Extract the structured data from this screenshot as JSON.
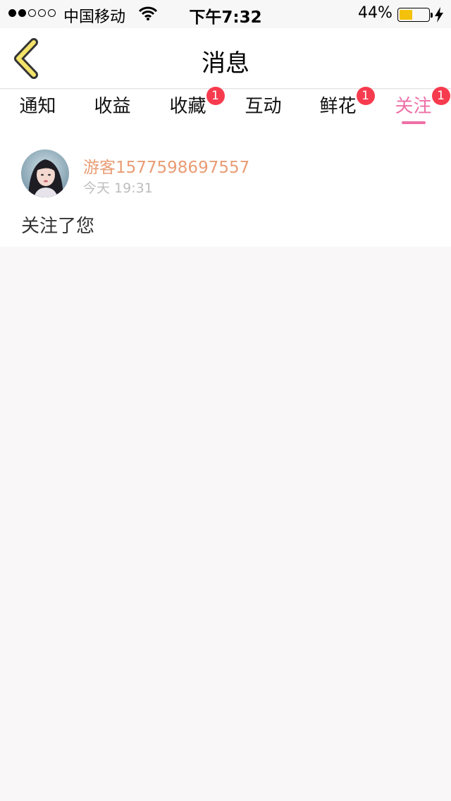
{
  "status_bar": {
    "carrier": "中国移动",
    "time": "下午7:32",
    "battery_percent": "44%",
    "battery_level": 0.44,
    "signal_filled": 2,
    "signal_total": 5,
    "icons": [
      "signal-dots-icon",
      "wifi-icon",
      "battery-icon",
      "charging-bolt-icon"
    ]
  },
  "nav": {
    "title": "消息",
    "back_icon": "chevron-left-icon",
    "back_icon_color": "#f3e36b"
  },
  "tabs": [
    {
      "label": "通知",
      "badge": "",
      "active": false
    },
    {
      "label": "收益",
      "badge": "",
      "active": false
    },
    {
      "label": "收藏",
      "badge": "1",
      "active": false
    },
    {
      "label": "互动",
      "badge": "",
      "active": false
    },
    {
      "label": "鲜花",
      "badge": "1",
      "active": false
    },
    {
      "label": "关注",
      "badge": "1",
      "active": true
    }
  ],
  "message": {
    "username": "游客1577598697557",
    "timestamp": "今天 19:31",
    "text": "关注了您",
    "avatar": "avatar-photo"
  },
  "colors": {
    "accent": "#ee6fa6",
    "username": "#e99c74",
    "badge": "#f73b4e",
    "background": "#f9f7f8"
  }
}
